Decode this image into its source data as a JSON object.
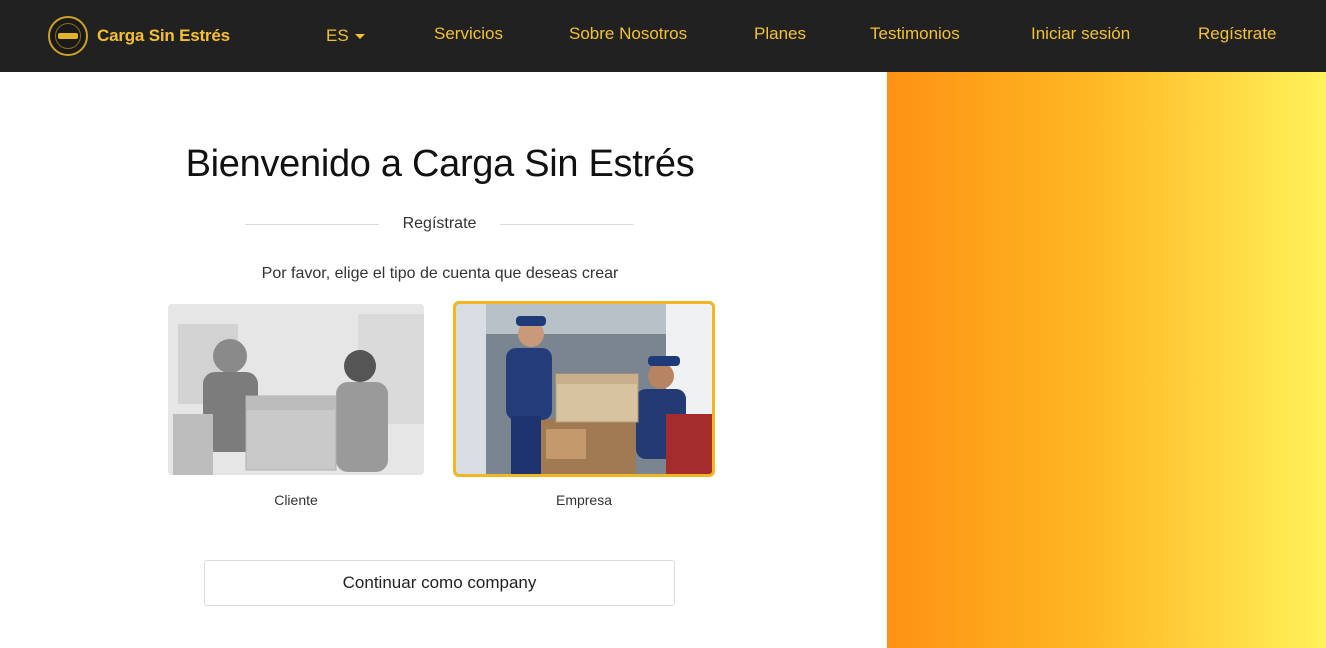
{
  "header": {
    "brand_name": "Carga Sin Estrés",
    "language": "ES",
    "nav": [
      {
        "label": "Servicios"
      },
      {
        "label": "Sobre Nosotros"
      },
      {
        "label": "Planes"
      },
      {
        "label": "Testimonios"
      },
      {
        "label": "Iniciar sesión"
      },
      {
        "label": "Regístrate"
      }
    ]
  },
  "main": {
    "title": "Bienvenido a Carga Sin Estrés",
    "section_label": "Regístrate",
    "prompt": "Por favor, elige el tipo de cuenta que deseas crear",
    "account_types": [
      {
        "label": "Cliente",
        "selected": false
      },
      {
        "label": "Empresa",
        "selected": true
      }
    ],
    "continue_label": "Continuar como company"
  },
  "colors": {
    "header_bg": "#212121",
    "accent": "#f2c230",
    "selected_border": "#f2b620",
    "gradient_start": "#fd9213",
    "gradient_end": "#fff25a"
  },
  "icons": [
    "company-logo-icon",
    "caret-down-icon"
  ]
}
